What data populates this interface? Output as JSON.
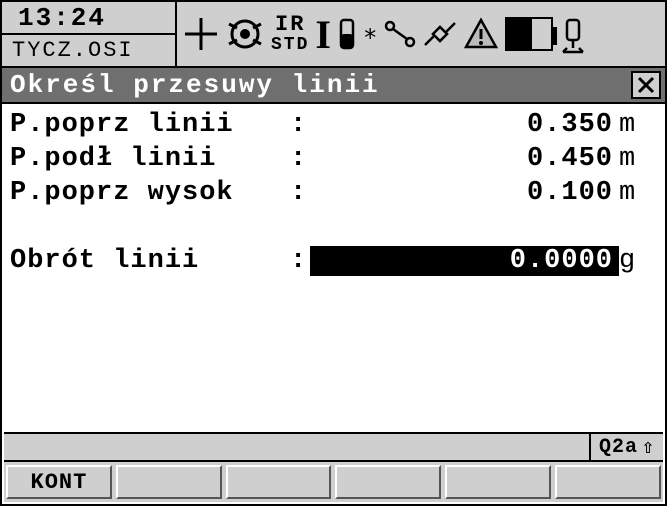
{
  "header": {
    "time": "13:24",
    "program": "TYCZ.OSI",
    "edm_mode_top": "IR",
    "edm_mode_bottom": "STD"
  },
  "titlebar": {
    "title": "Określ przesuwy linii"
  },
  "fields": [
    {
      "label": "P.poprz linii",
      "value": "0.350",
      "unit": "m",
      "selected": false
    },
    {
      "label": "P.podł linii ",
      "value": "0.450",
      "unit": "m",
      "selected": false
    },
    {
      "label": "P.poprz wysok",
      "value": "0.100",
      "unit": "m",
      "selected": false
    }
  ],
  "rotation": {
    "label": "Obrót linii  ",
    "value": "0.0000",
    "unit": "g",
    "selected": true
  },
  "panel_indicator": "Q2a",
  "softkeys": [
    "KONT",
    "",
    "",
    "",
    "",
    ""
  ]
}
